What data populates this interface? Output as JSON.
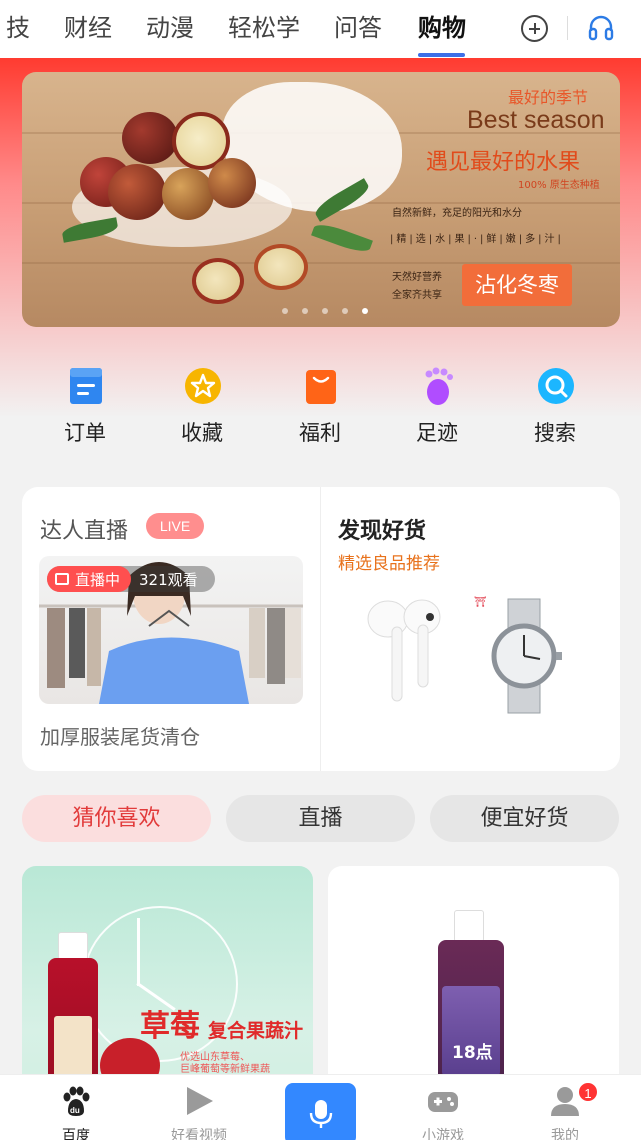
{
  "top_tabs": {
    "items": [
      {
        "label": "技"
      },
      {
        "label": "财经"
      },
      {
        "label": "动漫"
      },
      {
        "label": "轻松学"
      },
      {
        "label": "问答"
      },
      {
        "label": "购物"
      }
    ],
    "active_index": 5,
    "accent_color": "#3d6fe8"
  },
  "banner": {
    "line1": "最好的季节",
    "line2": "Best season",
    "line3": "遇见最好的水果",
    "line4": "100% 原生态种植",
    "line5": "自然新鲜，充足的阳光和水分",
    "line6": "|精|选|水|果|·|鲜|嫩|多|汁|",
    "line7": "天然好营养",
    "line8": "全家齐共享",
    "badge": "沾化冬枣",
    "slide_count": 5,
    "active_slide": 4
  },
  "quick_actions": [
    {
      "label": "订单",
      "icon": "order-icon",
      "color": "#3d8bf2"
    },
    {
      "label": "收藏",
      "icon": "star-icon",
      "color": "#f5b400"
    },
    {
      "label": "福利",
      "icon": "gift-bag-icon",
      "color": "#ff6a1a"
    },
    {
      "label": "足迹",
      "icon": "footprint-icon",
      "color": "#a24dff"
    },
    {
      "label": "搜索",
      "icon": "search-icon",
      "color": "#19b8ff"
    }
  ],
  "live": {
    "title": "达人直播",
    "badge": "LIVE",
    "status": "直播中",
    "viewers": "321观看",
    "caption": "加厚服装尾货清仓"
  },
  "discover": {
    "title": "发现好货",
    "subtitle": "精选良品推荐"
  },
  "filter_chips": [
    {
      "label": "猜你喜欢"
    },
    {
      "label": "直播"
    },
    {
      "label": "便宜好货"
    }
  ],
  "products": {
    "left": {
      "title_big": "草莓",
      "title_small": "复合果蔬汁",
      "note1": "优选山东草莓、",
      "note2": "巨峰葡萄等新鲜果蔬"
    },
    "right": {
      "label": "18点"
    }
  },
  "bottom_nav": [
    {
      "label": "百度",
      "icon": "baidu-paw-icon"
    },
    {
      "label": "好看视频",
      "icon": "play-icon"
    },
    {
      "label": "",
      "icon": "microphone-icon"
    },
    {
      "label": "小游戏",
      "icon": "gamepad-icon"
    },
    {
      "label": "我的",
      "icon": "user-icon"
    }
  ],
  "notification_count": "1"
}
